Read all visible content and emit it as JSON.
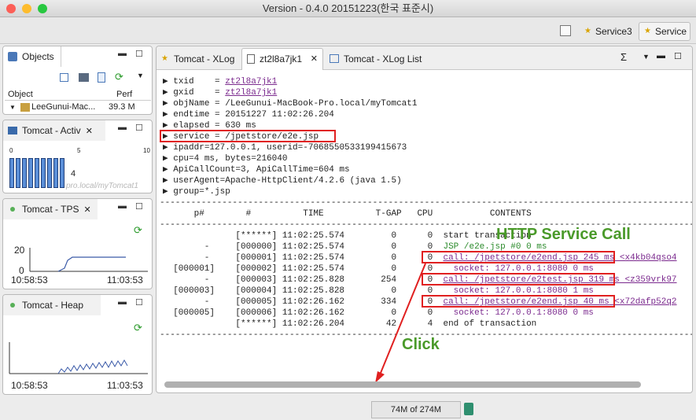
{
  "window": {
    "title": "Version - 0.4.0 20151223(한국 표준시)"
  },
  "toolbar": {
    "service3_label": "Service3",
    "service_label": "Service"
  },
  "objects_panel": {
    "tab_label": "Objects",
    "col_object": "Object",
    "col_perf": "Perf",
    "row_name": "LeeGunui-Mac...",
    "row_perf": "39.3 M"
  },
  "activ_panel": {
    "tab_label": "Tomcat - Activ",
    "ticks": [
      "0",
      "5",
      "10"
    ],
    "count": "4",
    "watermark": "pro.local/myTomcat1",
    "bars": 9
  },
  "tps_panel": {
    "tab_label": "Tomcat - TPS",
    "y_max": "20",
    "y_min": "0",
    "x_start": "10:58:53",
    "x_end": "11:03:53"
  },
  "heap_panel": {
    "tab_label": "Tomcat - Heap",
    "y_max": "100",
    "y_min": "0",
    "x_start": "10:58:53",
    "x_end": "11:03:53"
  },
  "main_tabs": [
    {
      "label": "Tomcat - XLog"
    },
    {
      "label": "zt2l8a7jk1"
    },
    {
      "label": "Tomcat - XLog List"
    }
  ],
  "details": {
    "txid_label": "▶ txid    = ",
    "txid": "zt2l8a7jk1",
    "gxid_label": "▶ gxid    = ",
    "gxid": "zt2l8a7jk1",
    "objName": "▶ objName = /LeeGunui-MacBook-Pro.local/myTomcat1",
    "endtime": "▶ endtime = 20151227 11:02:26.204",
    "elapsed": "▶ elapsed = 630 ms",
    "service": "▶ service = /jpetstore/e2e.jsp",
    "ipaddr": "▶ ipaddr=127.0.0.1, userid=-7068550533199415673",
    "cpu": "▶ cpu=4 ms, bytes=216040",
    "apicall": "▶ ApiCallCount=3, ApiCallTime=604 ms",
    "useragent": "▶ userAgent=Apache-HttpClient/4.2.6 (java 1.5)",
    "group": "▶ group=*.jsp"
  },
  "profile": {
    "divider": "--------------------------------------------------------------------------------------------------------",
    "header": "      p#        #          TIME          T-GAP   CPU           CONTENTS",
    "rows": [
      {
        "pre": "              [******] 11:02:25.574         0      0  ",
        "text": "start transaction",
        "cls": ""
      },
      {
        "pre": "        -     [000000] 11:02:25.574         0      0  ",
        "text": "JSP /e2e.jsp #0 0 ms",
        "cls": "green"
      },
      {
        "pre": "        -     [000001] 11:02:25.574         0      0  ",
        "text": "call: /jpetstore/e2end.jsp 245 ms",
        "cls": "link",
        "tail": " <x4kb04qso4"
      },
      {
        "pre": "  [000001]    [000002] 11:02:25.574         0      0    ",
        "text": "socket: 127.0.0.1:8080 0 ms",
        "cls": "purple"
      },
      {
        "pre": "        -     [000003] 11:02:25.828       254      0  ",
        "text": "call: /jpetstore/e2test.jsp 319 ms",
        "cls": "link",
        "tail": " <z359vrk97"
      },
      {
        "pre": "  [000003]    [000004] 11:02:25.828         0      0    ",
        "text": "socket: 127.0.0.1:8080 1 ms",
        "cls": "purple"
      },
      {
        "pre": "        -     [000005] 11:02:26.162       334      0  ",
        "text": "call: /jpetstore/e2end.jsp 40 ms",
        "cls": "link",
        "tail": " <x72dafp52q2"
      },
      {
        "pre": "  [000005]    [000006] 11:02:26.162         0      0    ",
        "text": "socket: 127.0.0.1:8080 0 ms",
        "cls": "purple"
      },
      {
        "pre": "              [******] 11:02:26.204        42      4  ",
        "text": "end of transaction",
        "cls": ""
      }
    ]
  },
  "annotations": {
    "http_service_call": "HTTP Service Call",
    "click": "Click"
  },
  "status": {
    "memory": "74M of 274M"
  },
  "colors": {
    "accent_red": "#e02020",
    "annotation_green": "#4a9a2a",
    "link_purple": "#7b2a8e"
  }
}
